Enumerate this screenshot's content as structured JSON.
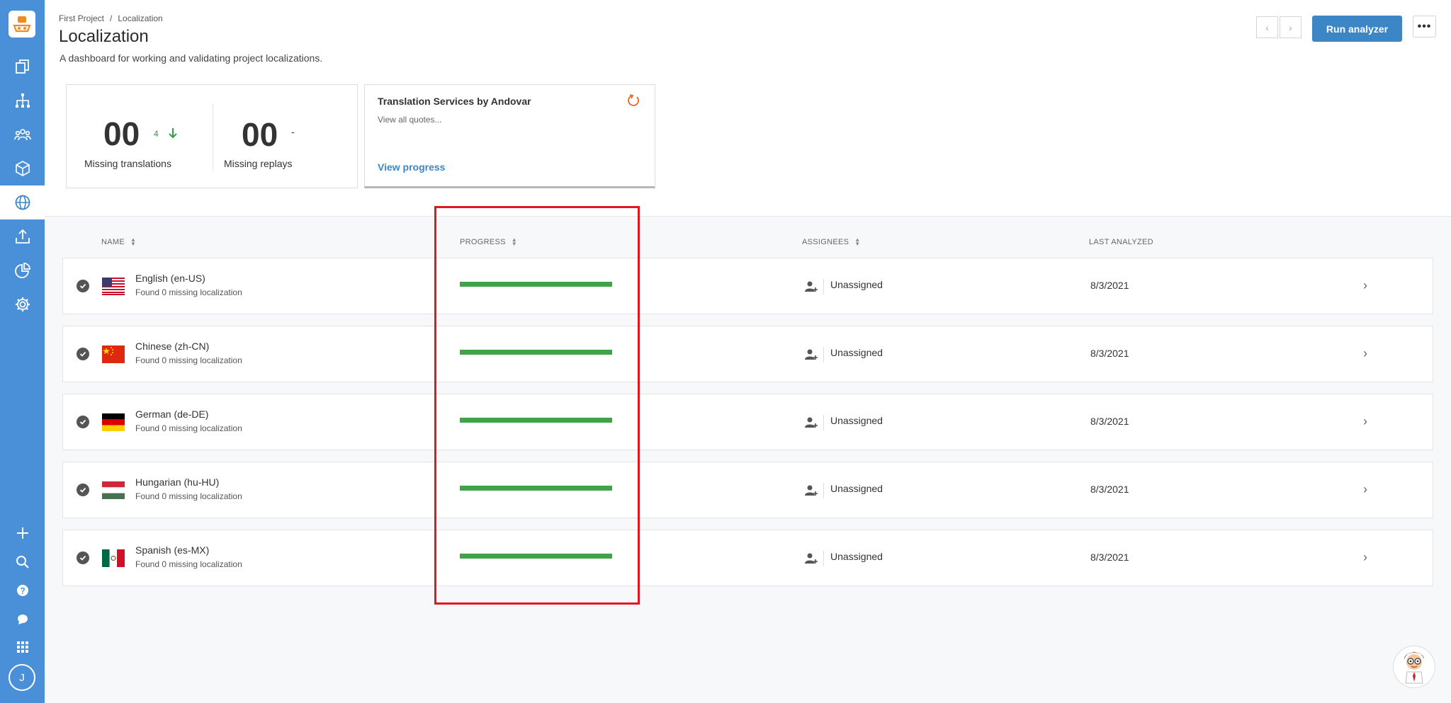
{
  "breadcrumb": {
    "project": "First Project",
    "current": "Localization"
  },
  "header": {
    "title": "Localization",
    "description": "A dashboard for working and validating project localizations.",
    "run_button": "Run analyzer"
  },
  "stats": {
    "missing_translations": {
      "value": "00",
      "delta": "4",
      "label": "Missing translations"
    },
    "missing_replays": {
      "value": "00",
      "delta": "-",
      "label": "Missing replays"
    }
  },
  "service": {
    "title": "Translation Services by Andovar",
    "subtitle": "View all quotes...",
    "link": "View progress"
  },
  "table": {
    "columns": {
      "name": "NAME",
      "progress": "PROGRESS",
      "assignees": "ASSIGNEES",
      "last_analyzed": "LAST ANALYZED"
    },
    "rows": [
      {
        "name": "English (en-US)",
        "sub": "Found 0 missing localization",
        "progress": 100,
        "assignee": "Unassigned",
        "date": "8/3/2021",
        "flag": "us"
      },
      {
        "name": "Chinese (zh-CN)",
        "sub": "Found 0 missing localization",
        "progress": 100,
        "assignee": "Unassigned",
        "date": "8/3/2021",
        "flag": "cn"
      },
      {
        "name": "German (de-DE)",
        "sub": "Found 0 missing localization",
        "progress": 100,
        "assignee": "Unassigned",
        "date": "8/3/2021",
        "flag": "de"
      },
      {
        "name": "Hungarian (hu-HU)",
        "sub": "Found 0 missing localization",
        "progress": 100,
        "assignee": "Unassigned",
        "date": "8/3/2021",
        "flag": "hu"
      },
      {
        "name": "Spanish (es-MX)",
        "sub": "Found 0 missing localization",
        "progress": 100,
        "assignee": "Unassigned",
        "date": "8/3/2021",
        "flag": "mx"
      }
    ]
  },
  "sidebar": {
    "avatar_initial": "J"
  },
  "colors": {
    "sidebar": "#4a90d9",
    "primary": "#3d86c6",
    "progress": "#3ca548",
    "highlight": "#e0171f"
  }
}
